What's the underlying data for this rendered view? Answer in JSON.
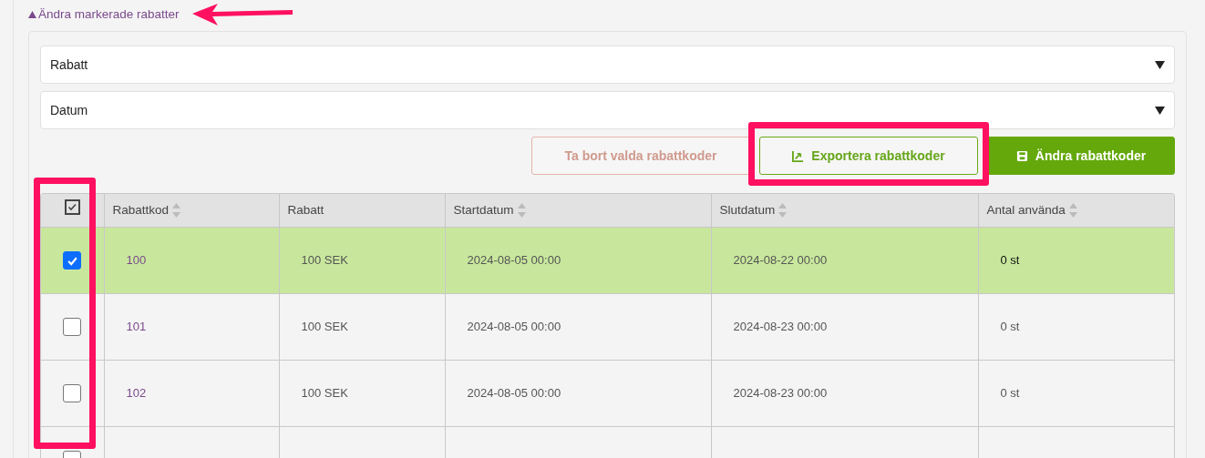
{
  "toggle": {
    "label": "Ändra markerade rabatter",
    "expanded": true
  },
  "selects": [
    {
      "value": "Rabatt"
    },
    {
      "value": "Datum"
    }
  ],
  "buttons": [
    {
      "kind": "danger-outline",
      "label": "Ta bort valda rabattkoder"
    },
    {
      "kind": "success-outline",
      "label": "Exportera rabattkoder"
    },
    {
      "kind": "success",
      "label": "Ändra rabattkoder"
    }
  ],
  "table": {
    "select_all": {
      "checked": true
    },
    "columns": [
      {
        "label": "Rabattkod",
        "sortable": true
      },
      {
        "label": "Rabatt",
        "sortable": false
      },
      {
        "label": "Startdatum",
        "sortable": true
      },
      {
        "label": "Slutdatum",
        "sortable": true
      },
      {
        "label": "Antal använda",
        "sortable": true
      }
    ],
    "rows": [
      {
        "selected": true,
        "cells": [
          "100",
          "100 SEK",
          "2024-08-05 00:00",
          "2024-08-22 00:00",
          "0 st"
        ]
      },
      {
        "selected": false,
        "cells": [
          "101",
          "100 SEK",
          "2024-08-05 00:00",
          "2024-08-23 00:00",
          "0 st"
        ]
      },
      {
        "selected": false,
        "cells": [
          "102",
          "100 SEK",
          "2024-08-05 00:00",
          "2024-08-23 00:00",
          "0 st"
        ]
      },
      {
        "selected": false
      }
    ]
  },
  "annotations": [
    {
      "kind": "arrow"
    },
    {
      "kind": "frame"
    },
    {
      "kind": "frame"
    }
  ]
}
